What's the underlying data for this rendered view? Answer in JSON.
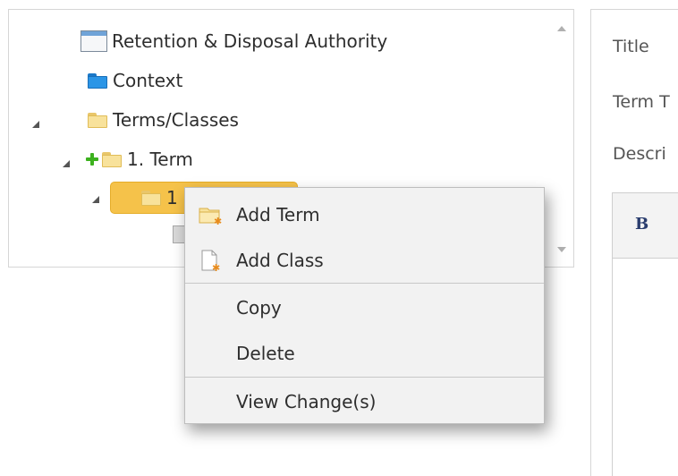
{
  "tree": {
    "items": [
      {
        "label": "Retention & Disposal Authority"
      },
      {
        "label": "Context"
      },
      {
        "label": "Terms/Classes"
      },
      {
        "label": "1. Term"
      },
      {
        "label": "1"
      }
    ]
  },
  "context_menu": {
    "items": [
      {
        "label": "Add Term",
        "icon": "add-term-folder-icon"
      },
      {
        "label": "Add Class",
        "icon": "add-class-document-icon"
      },
      {
        "label": "Copy"
      },
      {
        "label": "Delete"
      },
      {
        "label": "View Change(s)"
      }
    ]
  },
  "form": {
    "title_label": "Title",
    "term_type_label": "Term T",
    "description_label": "Descri",
    "bold_label": "B"
  },
  "colors": {
    "selection": "#f5c24a",
    "folder_yellow": "#f8e29b",
    "folder_blue": "#2b95e6",
    "plus_green": "#3cb11e",
    "menu_bg": "#f2f2f2"
  }
}
